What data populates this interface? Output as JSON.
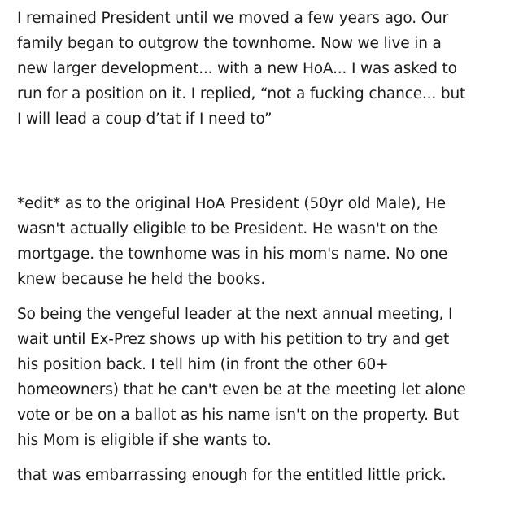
{
  "paragraphs": [
    {
      "lines": [
        "I remained President until we moved a few years ago. Our",
        "family began to outgrow the townhome. Now we live in a",
        "new larger development... with a new HoA... I was asked to",
        "run for a position on it. I replied, “not a fucking chance... but",
        "I will lead a coup d’tat if I need to”"
      ]
    },
    {
      "lines": [
        "*edit* as to the original HoA President (50yr old Male), He",
        "wasn't actually eligible to be President. He wasn't on the",
        "mortgage. the townhome was in his mom's name. No one",
        "knew because he held the books."
      ]
    },
    {
      "lines": [
        "So being the vengeful leader at the next annual meeting, I",
        "wait until Ex-Prez shows up with his petition to try and get",
        "his position back. I tell him (in front the other 60+",
        "homeowners) that he can't even be at the meeting let alone",
        "vote or be on a ballot as his name isn't on the property. But",
        "his Mom is eligible if she wants to."
      ]
    },
    {
      "lines": [
        "that was embarrassing enough for the entitled little prick."
      ]
    }
  ]
}
